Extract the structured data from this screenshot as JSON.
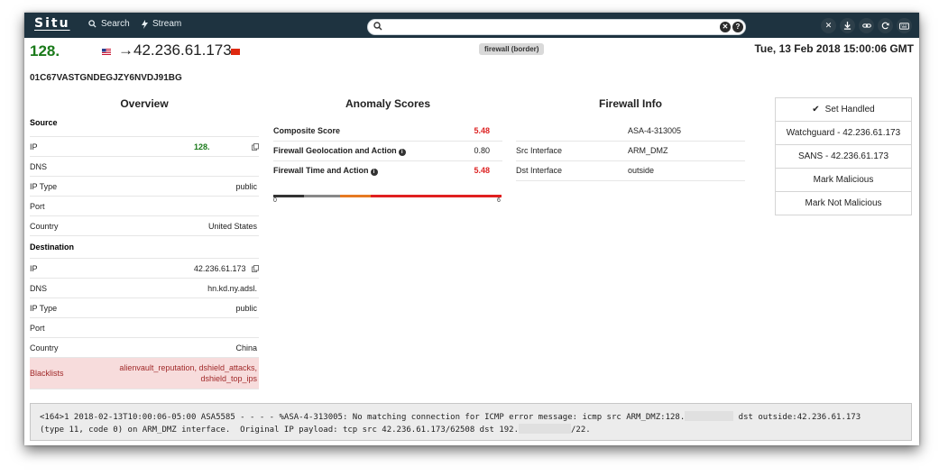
{
  "nav": {
    "logo": "Situ",
    "search_label": "Search",
    "stream_label": "Stream",
    "search_value": "",
    "search_placeholder": ""
  },
  "header": {
    "source_ip": "128.",
    "dest_ip": "→42.236.61.173",
    "badge": "firewall (border)",
    "timestamp": "Tue, 13 Feb 2018 15:00:06 GMT",
    "event_id": "01C67VASTGNDEGJZY6NVDJ91BG"
  },
  "overview": {
    "title": "Overview",
    "source_heading": "Source",
    "destination_heading": "Destination",
    "source": [
      {
        "key": "IP",
        "value": "128."
      },
      {
        "key": "DNS",
        "value": ""
      },
      {
        "key": "IP Type",
        "value": "public"
      },
      {
        "key": "Port",
        "value": ""
      },
      {
        "key": "Country",
        "value": "United States"
      }
    ],
    "destination": [
      {
        "key": "IP",
        "value": "42.236.61.173"
      },
      {
        "key": "DNS",
        "value": "hn.kd.ny.adsl."
      },
      {
        "key": "IP Type",
        "value": "public"
      },
      {
        "key": "Port",
        "value": ""
      },
      {
        "key": "Country",
        "value": "China"
      }
    ],
    "blacklists_key": "Blacklists",
    "blacklists_line1": "alienvault_reputation, dshield_attacks,",
    "blacklists_line2": "dshield_top_ips"
  },
  "anomaly": {
    "title": "Anomaly Scores",
    "rows": [
      {
        "key": "Composite Score",
        "value": "5.48",
        "color": "#dd2222"
      },
      {
        "key": "Firewall Geolocation and Action",
        "value": "0.80",
        "color": "#222222"
      },
      {
        "key": "Firewall Time and Action",
        "value": "5.48",
        "color": "#dd2222"
      }
    ],
    "scale_min": "0",
    "scale_max": "6",
    "scale_value": 5.48
  },
  "firewall": {
    "title": "Firewall Info",
    "rows": [
      {
        "key": "",
        "value": "ASA-4-313005"
      },
      {
        "key": "Src Interface",
        "value": "ARM_DMZ"
      },
      {
        "key": "Dst Interface",
        "value": "outside"
      }
    ]
  },
  "actions": {
    "set_handled": "Set Handled",
    "watchguard": "Watchguard - 42.236.61.173",
    "sans": "SANS - 42.236.61.173",
    "mark_malicious": "Mark Malicious",
    "mark_not_malicious": "Mark Not Malicious"
  },
  "log": {
    "line1_a": "<164>1 2018-02-13T10:00:06-05:00 ASA5585 - - - - %ASA-4-313005: No matching connection for ICMP error message: icmp src ARM_DMZ:128.",
    "line1_b": " dst outside:42.236.61.173",
    "line2_a": "(type 11, code 0) on ARM_DMZ interface.  Original IP payload: tcp src 42.236.61.173/62508 dst 192.",
    "line2_b": "/22."
  },
  "colors": {
    "nav_bg": "#1e3340",
    "source_ip": "#1a7a1a",
    "score_high": "#dd2222",
    "blacklist_bg": "#f7dcdc"
  },
  "icons": [
    "search-icon",
    "lightning-icon",
    "clear-icon",
    "help-icon",
    "close-icon",
    "download-icon",
    "link-icon",
    "refresh-icon",
    "keyboard-icon",
    "copy-icon",
    "info-icon",
    "check-icon"
  ]
}
